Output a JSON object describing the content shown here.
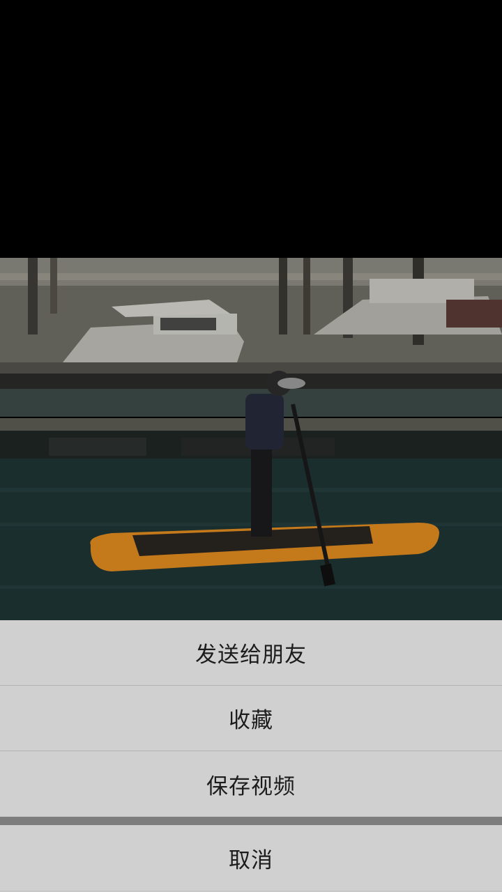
{
  "action_sheet": {
    "items": [
      {
        "label": "发送给朋友"
      },
      {
        "label": "收藏"
      },
      {
        "label": "保存视频"
      }
    ],
    "cancel_label": "取消"
  },
  "colors": {
    "backdrop": "#000000",
    "sheet_item_bg": "#d0d0d0",
    "sheet_divider": "#b3b3b3",
    "sheet_gap": "#7d7d7d",
    "board_orange": "#e88a1c",
    "water": "#1f3a3a"
  },
  "video": {
    "subject": "person paddleboarding in marina"
  }
}
